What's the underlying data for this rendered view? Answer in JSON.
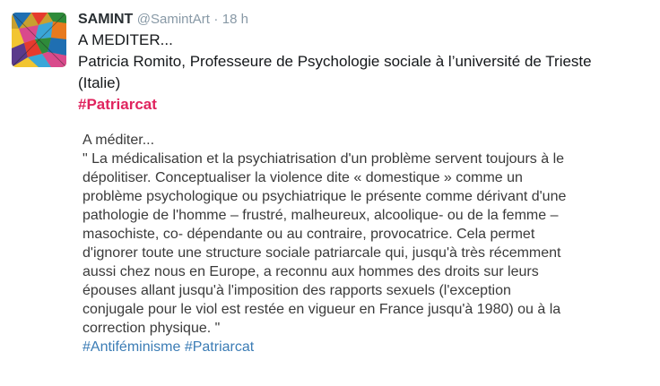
{
  "tweet": {
    "author_name": "SAMINT",
    "author_handle": "@SamintArt",
    "separator": "·",
    "time": "18 h",
    "text_lines": [
      "A MEDITER...",
      "Patricia Romito, Professeure de Psychologie sociale à l’université de Trieste",
      "(Italie)"
    ],
    "hashtag": "#Patriarcat"
  },
  "quote_image": {
    "lines": [
      "A méditer...",
      "\" La médicalisation et la psychiatrisation d'un problème servent toujours à le",
      "dépolitiser. Conceptualiser la violence dite « domestique » comme un",
      "problème psychologique ou psychiatrique le présente comme dérivant d'une",
      "pathologie de l'homme – frustré, malheureux, alcoolique- ou de la femme –",
      "masochiste, co- dépendante ou au contraire, provocatrice. Cela permet",
      "d'ignorer toute une structure sociale patriarcale qui, jusqu'à très récemment",
      "aussi chez nous en Europe, a reconnu aux hommes des droits sur leurs",
      "épouses allant jusqu'à l'imposition des rapports sexuels (l'exception",
      "conjugale pour le viol est restée en vigueur en France jusqu'à 1980) ou à la",
      "correction physique. \""
    ],
    "tag_1": "#Antiféminisme",
    "tag_2": "#Patriarcat"
  },
  "colors": {
    "hashtag": "#e0245e",
    "meta_gray": "#8899a6",
    "image_tag_blue": "#3b7cb5"
  }
}
